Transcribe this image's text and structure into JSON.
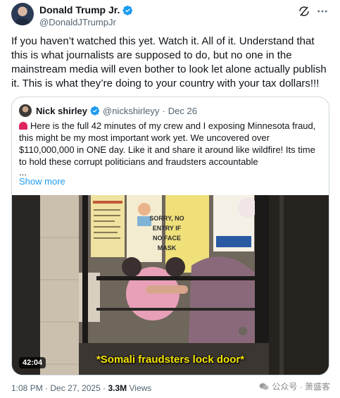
{
  "colors": {
    "accent": "#1d9bf0",
    "verified": "#1d9bf0",
    "text": "#0f1419",
    "muted": "#536471",
    "border": "#cfd9de",
    "caption": "#f5e400",
    "alert": "#e0245e"
  },
  "tweet": {
    "author_name": "Donald Trump Jr.",
    "author_handle": "@DonaldJTrumpJr",
    "text": "If you haven’t watched this yet. Watch it. All of it. Understand that this is what journalists are supposed to do, but no one in the mainstream media will even bother to look let alone actually publish it. This is what they’re doing to your country with your tax dollars!!!",
    "time": "1:08 PM",
    "date": "Dec 27, 2025",
    "views_count": "3.3M",
    "views_label": "Views",
    "separator": "·"
  },
  "quote": {
    "author_name": "Nick shirley",
    "author_handle": "@nickshirleyy",
    "separator": "·",
    "date": "Dec 26",
    "text": "Here is the full 42 minutes of my crew and I exposing Minnesota fraud, this might be my most important work yet. We uncovered over $110,000,000 in ONE day. Like it and share it around like wildfire! Its time to hold these corrupt politicians and fraudsters accountable",
    "ellipsis": "...",
    "show_more": "Show more"
  },
  "video": {
    "duration": "42:04",
    "caption": "*Somali fraudsters lock door*",
    "signs": {
      "notice": "SORRY, NO ENTRY IF NO FACE MASK"
    }
  },
  "watermark": {
    "text": "公众号 · 萧盛客"
  },
  "icons": {
    "verified": "verified-badge-icon",
    "grok": "grok-icon",
    "more": "more-icon",
    "siren": "siren-icon",
    "watermark": "wechat-icon"
  }
}
